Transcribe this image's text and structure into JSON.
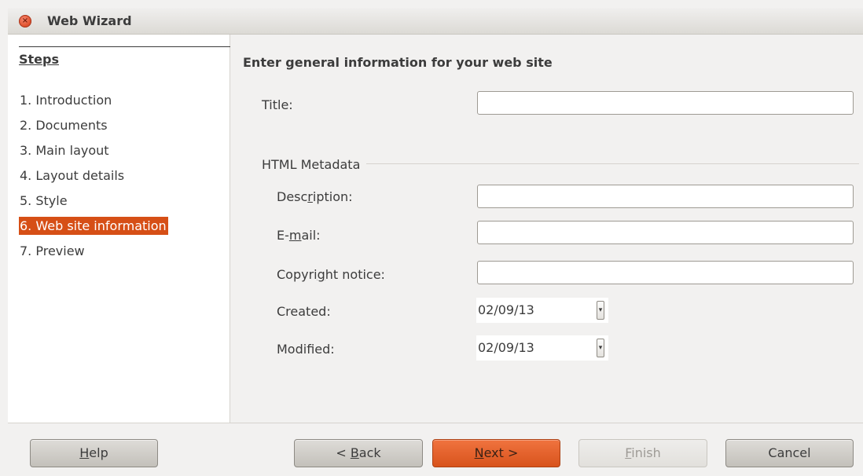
{
  "window": {
    "title": "Web Wizard",
    "close_glyph": "×"
  },
  "steps": {
    "heading": "Steps",
    "items": [
      {
        "label": "1. Introduction",
        "active": false
      },
      {
        "label": "2. Documents",
        "active": false
      },
      {
        "label": "3. Main layout",
        "active": false
      },
      {
        "label": "4. Layout details",
        "active": false
      },
      {
        "label": "5. Style",
        "active": false
      },
      {
        "label": "6. Web site information",
        "active": true
      },
      {
        "label": "7. Preview",
        "active": false
      }
    ]
  },
  "form": {
    "section_title": "Enter general information for your web site",
    "title_label": "Title:",
    "title_value": "",
    "metadata_group": "HTML Metadata",
    "description_label_pre": "Desc",
    "description_label_ul": "r",
    "description_label_post": "iption:",
    "description_value": "",
    "email_label_pre": "E-",
    "email_label_ul": "m",
    "email_label_post": "ail:",
    "email_value": "",
    "copyright_label_pre": "Copyri",
    "copyright_label_ul": "g",
    "copyright_label_post": "ht notice:",
    "copyright_value": "",
    "created_label": "Created:",
    "created_value": "02/09/13",
    "modified_label": "Modified:",
    "modified_value": "02/09/13",
    "spin_glyph": "▾"
  },
  "buttons": {
    "help_ul": "H",
    "help_rest": "elp",
    "back_pre": "< ",
    "back_ul": "B",
    "back_rest": "ack",
    "next_ul": "N",
    "next_rest": "ext >",
    "finish_ul": "F",
    "finish_rest": "inish",
    "cancel": "Cancel"
  },
  "colors": {
    "accent": "#d64f16",
    "default_button": "#e9622b",
    "window_bg": "#f2f1f0"
  }
}
